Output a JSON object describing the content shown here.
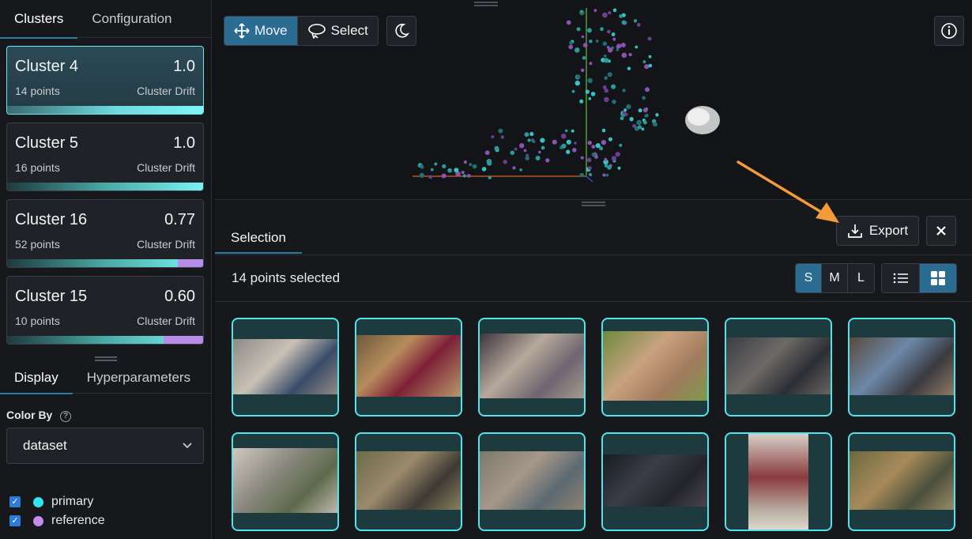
{
  "sidebar": {
    "tabs": [
      "Clusters",
      "Configuration"
    ],
    "clusters": [
      {
        "name": "Cluster 4",
        "score": "1.0",
        "points": "14 points",
        "metric": "Cluster Drift",
        "reference_fraction": 0
      },
      {
        "name": "Cluster 5",
        "score": "1.0",
        "points": "16 points",
        "metric": "Cluster Drift",
        "reference_fraction": 0
      },
      {
        "name": "Cluster 16",
        "score": "0.77",
        "points": "52 points",
        "metric": "Cluster Drift",
        "reference_fraction": 0.13
      },
      {
        "name": "Cluster 15",
        "score": "0.60",
        "points": "10 points",
        "metric": "Cluster Drift",
        "reference_fraction": 0.2
      }
    ],
    "display_tabs": [
      "Display",
      "Hyperparameters"
    ],
    "color_by_label": "Color By",
    "color_by_value": "dataset",
    "legend": [
      {
        "label": "primary",
        "color": "#2ee6f0",
        "checked": true
      },
      {
        "label": "reference",
        "color": "#c08cf0",
        "checked": true
      }
    ]
  },
  "toolbar": {
    "move_label": "Move",
    "select_label": "Select"
  },
  "selection": {
    "tab_label": "Selection",
    "export_label": "Export",
    "count_text": "14 points selected",
    "sizes": [
      "S",
      "M",
      "L"
    ]
  },
  "colors": {
    "accent": "#2b6c93",
    "thumb_border": "#4fe3ea",
    "arrow": "#f39a3a"
  }
}
